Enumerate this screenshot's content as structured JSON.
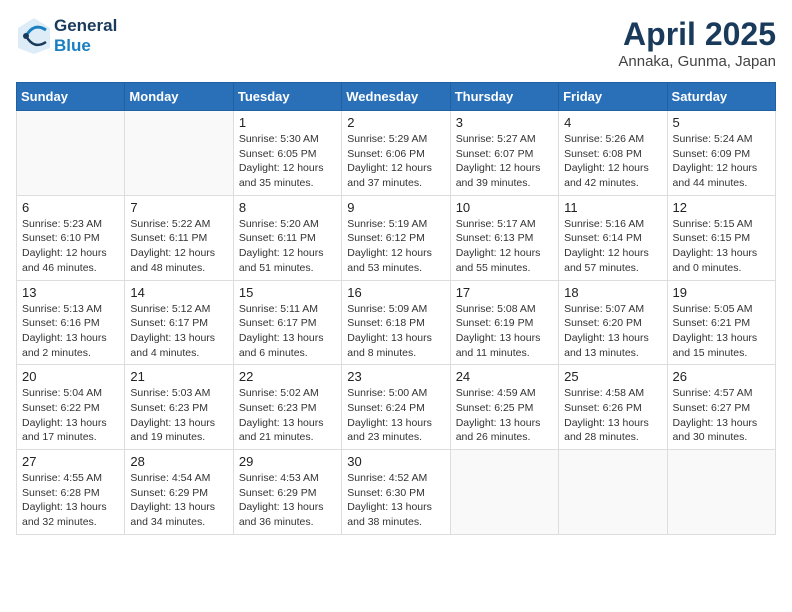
{
  "header": {
    "logo_general": "General",
    "logo_blue": "Blue",
    "month": "April 2025",
    "location": "Annaka, Gunma, Japan"
  },
  "weekdays": [
    "Sunday",
    "Monday",
    "Tuesday",
    "Wednesday",
    "Thursday",
    "Friday",
    "Saturday"
  ],
  "weeks": [
    [
      {
        "day": "",
        "detail": ""
      },
      {
        "day": "",
        "detail": ""
      },
      {
        "day": "1",
        "detail": "Sunrise: 5:30 AM\nSunset: 6:05 PM\nDaylight: 12 hours and 35 minutes."
      },
      {
        "day": "2",
        "detail": "Sunrise: 5:29 AM\nSunset: 6:06 PM\nDaylight: 12 hours and 37 minutes."
      },
      {
        "day": "3",
        "detail": "Sunrise: 5:27 AM\nSunset: 6:07 PM\nDaylight: 12 hours and 39 minutes."
      },
      {
        "day": "4",
        "detail": "Sunrise: 5:26 AM\nSunset: 6:08 PM\nDaylight: 12 hours and 42 minutes."
      },
      {
        "day": "5",
        "detail": "Sunrise: 5:24 AM\nSunset: 6:09 PM\nDaylight: 12 hours and 44 minutes."
      }
    ],
    [
      {
        "day": "6",
        "detail": "Sunrise: 5:23 AM\nSunset: 6:10 PM\nDaylight: 12 hours and 46 minutes."
      },
      {
        "day": "7",
        "detail": "Sunrise: 5:22 AM\nSunset: 6:11 PM\nDaylight: 12 hours and 48 minutes."
      },
      {
        "day": "8",
        "detail": "Sunrise: 5:20 AM\nSunset: 6:11 PM\nDaylight: 12 hours and 51 minutes."
      },
      {
        "day": "9",
        "detail": "Sunrise: 5:19 AM\nSunset: 6:12 PM\nDaylight: 12 hours and 53 minutes."
      },
      {
        "day": "10",
        "detail": "Sunrise: 5:17 AM\nSunset: 6:13 PM\nDaylight: 12 hours and 55 minutes."
      },
      {
        "day": "11",
        "detail": "Sunrise: 5:16 AM\nSunset: 6:14 PM\nDaylight: 12 hours and 57 minutes."
      },
      {
        "day": "12",
        "detail": "Sunrise: 5:15 AM\nSunset: 6:15 PM\nDaylight: 13 hours and 0 minutes."
      }
    ],
    [
      {
        "day": "13",
        "detail": "Sunrise: 5:13 AM\nSunset: 6:16 PM\nDaylight: 13 hours and 2 minutes."
      },
      {
        "day": "14",
        "detail": "Sunrise: 5:12 AM\nSunset: 6:17 PM\nDaylight: 13 hours and 4 minutes."
      },
      {
        "day": "15",
        "detail": "Sunrise: 5:11 AM\nSunset: 6:17 PM\nDaylight: 13 hours and 6 minutes."
      },
      {
        "day": "16",
        "detail": "Sunrise: 5:09 AM\nSunset: 6:18 PM\nDaylight: 13 hours and 8 minutes."
      },
      {
        "day": "17",
        "detail": "Sunrise: 5:08 AM\nSunset: 6:19 PM\nDaylight: 13 hours and 11 minutes."
      },
      {
        "day": "18",
        "detail": "Sunrise: 5:07 AM\nSunset: 6:20 PM\nDaylight: 13 hours and 13 minutes."
      },
      {
        "day": "19",
        "detail": "Sunrise: 5:05 AM\nSunset: 6:21 PM\nDaylight: 13 hours and 15 minutes."
      }
    ],
    [
      {
        "day": "20",
        "detail": "Sunrise: 5:04 AM\nSunset: 6:22 PM\nDaylight: 13 hours and 17 minutes."
      },
      {
        "day": "21",
        "detail": "Sunrise: 5:03 AM\nSunset: 6:23 PM\nDaylight: 13 hours and 19 minutes."
      },
      {
        "day": "22",
        "detail": "Sunrise: 5:02 AM\nSunset: 6:23 PM\nDaylight: 13 hours and 21 minutes."
      },
      {
        "day": "23",
        "detail": "Sunrise: 5:00 AM\nSunset: 6:24 PM\nDaylight: 13 hours and 23 minutes."
      },
      {
        "day": "24",
        "detail": "Sunrise: 4:59 AM\nSunset: 6:25 PM\nDaylight: 13 hours and 26 minutes."
      },
      {
        "day": "25",
        "detail": "Sunrise: 4:58 AM\nSunset: 6:26 PM\nDaylight: 13 hours and 28 minutes."
      },
      {
        "day": "26",
        "detail": "Sunrise: 4:57 AM\nSunset: 6:27 PM\nDaylight: 13 hours and 30 minutes."
      }
    ],
    [
      {
        "day": "27",
        "detail": "Sunrise: 4:55 AM\nSunset: 6:28 PM\nDaylight: 13 hours and 32 minutes."
      },
      {
        "day": "28",
        "detail": "Sunrise: 4:54 AM\nSunset: 6:29 PM\nDaylight: 13 hours and 34 minutes."
      },
      {
        "day": "29",
        "detail": "Sunrise: 4:53 AM\nSunset: 6:29 PM\nDaylight: 13 hours and 36 minutes."
      },
      {
        "day": "30",
        "detail": "Sunrise: 4:52 AM\nSunset: 6:30 PM\nDaylight: 13 hours and 38 minutes."
      },
      {
        "day": "",
        "detail": ""
      },
      {
        "day": "",
        "detail": ""
      },
      {
        "day": "",
        "detail": ""
      }
    ]
  ]
}
